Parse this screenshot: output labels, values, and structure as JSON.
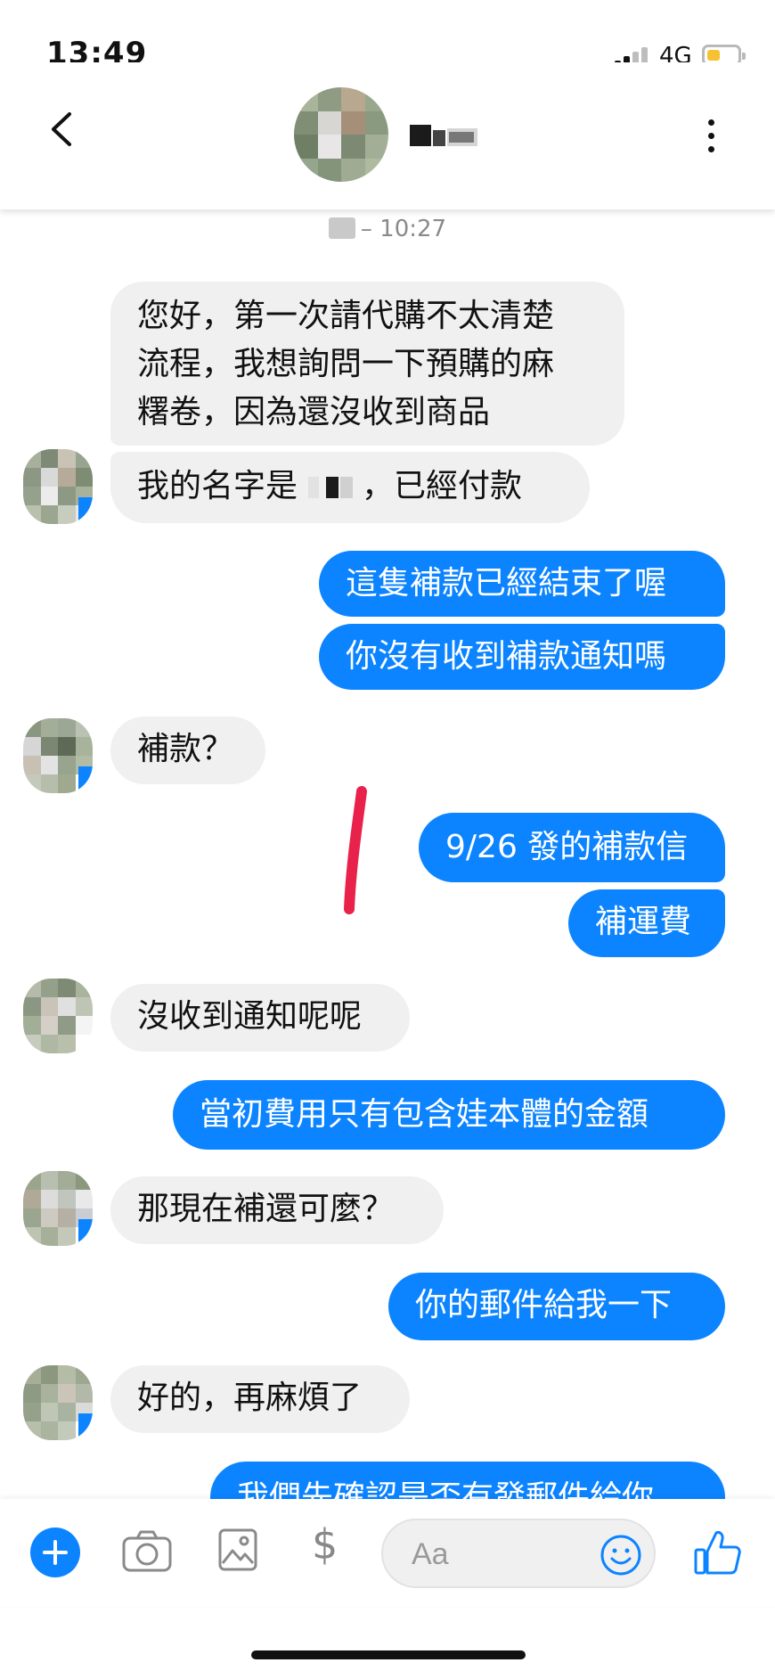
{
  "status_bar": {
    "time": "13:49",
    "network": "4G",
    "battery_level": 0.35,
    "battery_color": "#f6c231"
  },
  "header": {
    "back_icon": "chevron-left-icon",
    "more_icon": "vertical-ellipsis-icon"
  },
  "timestamp": "– 10:27",
  "messages": [
    {
      "from": "them",
      "text_lines": [
        "您好，第一次請代購不太清楚",
        "流程，我想詢問一下預購的麻",
        "糬卷，因為還沒收到商品"
      ]
    },
    {
      "from": "them",
      "text_before": "我的名字是",
      "text_after": "，已經付款"
    },
    {
      "from": "me",
      "text": "這隻補款已經結束了喔"
    },
    {
      "from": "me",
      "text": "你沒有收到補款通知嗎"
    },
    {
      "from": "them",
      "text": "補款？"
    },
    {
      "from": "me",
      "text": "9/26 發的補款信"
    },
    {
      "from": "me",
      "text": "補運費"
    },
    {
      "from": "them",
      "text": "沒收到通知呢呢"
    },
    {
      "from": "me",
      "text": "當初費用只有包含娃本體的金額"
    },
    {
      "from": "them",
      "text": "那現在補還可麼？"
    },
    {
      "from": "me",
      "text": "你的郵件給我一下"
    },
    {
      "from": "them",
      "text": "好的，再麻煩了"
    },
    {
      "from": "me",
      "text": "我們先確認是否有發郵件給你"
    }
  ],
  "composer": {
    "placeholder": "Aa",
    "dollar": "$",
    "icons": [
      "plus-icon",
      "camera-icon",
      "image-icon",
      "dollar-icon",
      "emoji-icon",
      "thumbs-up-icon"
    ]
  },
  "colors": {
    "outgoing_bubble": "#0c84ff",
    "incoming_bubble": "#f1f0f0",
    "annotation_mark": "#e8224a"
  }
}
